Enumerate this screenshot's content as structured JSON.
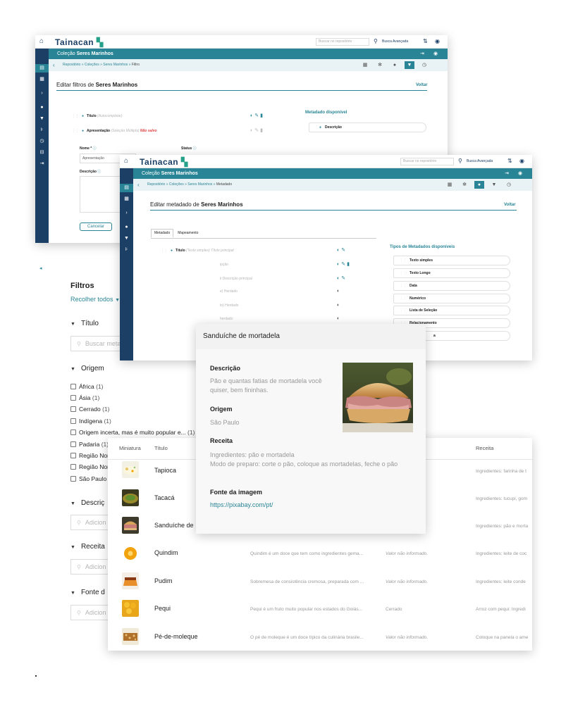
{
  "filters_window": {
    "logo": "Tainacan",
    "search_placeholder": "Buscar no repositório",
    "advanced_search": "Busca Avançada",
    "collection_prefix": "Coleção",
    "collection_name": "Seres Marinhos",
    "breadcrumb": {
      "repo": "Repositório",
      "collections": "Coleções",
      "collection": "Seres Marinhos",
      "current": "Filtro",
      "sep": "»"
    },
    "page_title_prefix": "Editar filtros de",
    "page_title_name": "Seres Marinhos",
    "back": "Voltar",
    "rows": [
      {
        "name": "Título",
        "type": "(Autocompletar)"
      },
      {
        "name": "Apresentação",
        "type": "(Seleção Múltipla)",
        "status": "Não salvo"
      }
    ],
    "available_title": "Metadado disponível",
    "available_items": [
      "Descrição"
    ],
    "form": {
      "name_label": "Nome",
      "name_value": "Apresentação",
      "status_label": "Status",
      "description_label": "Descrição",
      "cancel": "Cancelar"
    }
  },
  "metadata_window": {
    "logo": "Tainacan",
    "search_placeholder": "Buscar no repositório",
    "advanced_search": "Busca Avançada",
    "collection_prefix": "Coleção",
    "collection_name": "Seres Marinhos",
    "breadcrumb": {
      "repo": "Repositório",
      "collections": "Coleções",
      "collection": "Seres Marinhos",
      "current": "Metadado",
      "sep": "»"
    },
    "page_title_prefix": "Editar metadado de",
    "page_title_name": "Seres Marinhos",
    "back": "Voltar",
    "tabs": [
      "Metadado",
      "Mapeamento"
    ],
    "first_row": {
      "name": "Título",
      "type": "(Texto simples)",
      "extra": "Título principal"
    },
    "partial_rows": [
      "ipção",
      "ii Descrição principal",
      "e) Herdado",
      "to) Herdado",
      "herdado"
    ],
    "types_title": "Tipos de Metadados disponíveis",
    "types": [
      "Texto simples",
      "Texto Longo",
      "Data",
      "Numérico",
      "Lista de Seleção",
      "Relacionamento",
      "a"
    ]
  },
  "filters_panel": {
    "title": "Filtros",
    "collapse_all": "Recolher todos",
    "sections": [
      {
        "label": "Título",
        "search": "Buscar metadados..."
      },
      {
        "label": "Origem"
      },
      {
        "label": "Descriç",
        "search": "Adicion"
      },
      {
        "label": "Receita",
        "search": "Adicion"
      },
      {
        "label": "Fonte d",
        "search": "Adicion"
      }
    ],
    "origins": [
      {
        "label": "África",
        "count": "(1)"
      },
      {
        "label": "Ásia",
        "count": "(1)"
      },
      {
        "label": "Cerrado",
        "count": "(1)"
      },
      {
        "label": "Indígena",
        "count": "(1)"
      },
      {
        "label": "Origem incerta, mas é muito popular e...",
        "count": "(1)"
      },
      {
        "label": "Padaria",
        "count": "(1)"
      },
      {
        "label": "Região Nor",
        "count": ""
      },
      {
        "label": "Região Nor",
        "count": ""
      },
      {
        "label": "São Paulo",
        "count": ""
      }
    ]
  },
  "table": {
    "headers": {
      "thumb": "Miniatura",
      "title": "Título",
      "recipe": "Receita"
    },
    "rows": [
      {
        "title": "Tapioca",
        "desc": "",
        "origin": "",
        "recipe": "Ingredientes: farinha de t"
      },
      {
        "title": "Tacacá",
        "desc": "",
        "origin": "",
        "recipe": "Ingredientes: tucupi, gom"
      },
      {
        "title": "Sanduíche de",
        "desc": "",
        "origin": "",
        "recipe": "Ingredientes: pão e morta"
      },
      {
        "title": "Quindim",
        "desc": "Quindim é um doce que tem como ingredientes gema...",
        "origin": "Valor não informado.",
        "recipe": "Ingredientes: leite de coc"
      },
      {
        "title": "Pudim",
        "desc": "Sobremesa de consistência cremosa, preparada com ...",
        "origin": "Valor não informado.",
        "recipe": "Ingredientes: leite conde"
      },
      {
        "title": "Pequi",
        "desc": "Pequi é um fruto muito popular nos estados do Goiás...",
        "origin": "Cerrado",
        "recipe": "Arroz com pequi: Ingredi"
      },
      {
        "title": "Pé-de-moleque",
        "desc": "O pé de moleque é um doce típico da culinária brasile...",
        "origin": "Valor não informado.",
        "recipe": "Coloque na panela o ame"
      }
    ]
  },
  "popup": {
    "title": "Sanduíche de mortadela",
    "description_label": "Descrição",
    "description": "Pão e quantas fatias de mortadela você quiser, bem fininhas.",
    "origin_label": "Origem",
    "origin": "São Paulo",
    "recipe_label": "Receita",
    "recipe_line1": "Ingredientes: pão e mortadela",
    "recipe_line2": "Modo de preparo: corte o pão, coloque as mortadelas, feche o pão",
    "source_label": "Fonte da imagem",
    "source_url": "https://pixabay.com/pt/"
  },
  "colors": {
    "navy": "#1c3f65",
    "teal": "#298596",
    "red": "#e04040"
  }
}
